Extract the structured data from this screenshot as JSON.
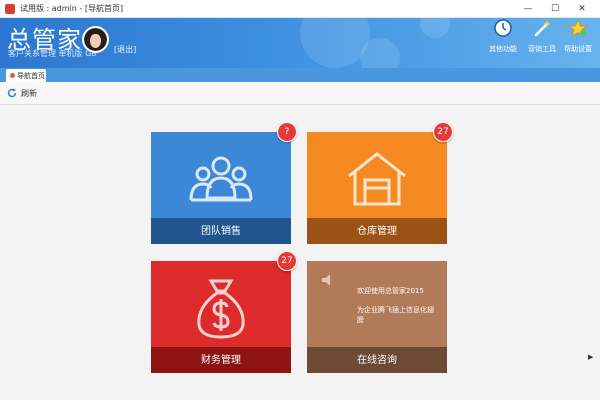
{
  "window": {
    "title": "试用版 : admin - [导航首页]",
    "minimize_glyph": "—",
    "maximize_glyph": "☐",
    "close_glyph": "✕"
  },
  "header": {
    "logo": "总管家",
    "subtitle": "客户关系管理 单机版 G8",
    "logout": "[退出]",
    "tools": [
      {
        "label": "其他功能",
        "icon": "clock-icon"
      },
      {
        "label": "营销工具",
        "icon": "magic-wand-icon"
      },
      {
        "label": "帮助设置",
        "icon": "help-settings-icon"
      }
    ]
  },
  "tabs": [
    {
      "label": "导航首页",
      "active": true
    }
  ],
  "toolbar": {
    "refresh_label": "刷新"
  },
  "tiles": {
    "team_sales": {
      "label": "团队销售",
      "badge": "?",
      "color": "#3c87d6"
    },
    "warehouse": {
      "label": "仓库管理",
      "badge": "27",
      "color": "#f68a22"
    },
    "finance": {
      "label": "财务管理",
      "badge": "27",
      "color": "#dd2a2a"
    },
    "consult": {
      "label": "在线咨询",
      "welcome": "欢迎使用总管家2015",
      "slogan": "为企业腾飞插上信息化翅膀",
      "color": "#b17a58"
    }
  },
  "colors": {
    "banner": "#3d8fe0",
    "badge": "#e53a3a"
  }
}
